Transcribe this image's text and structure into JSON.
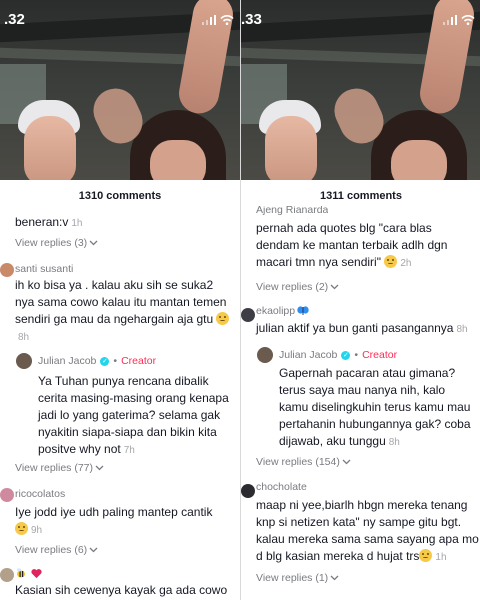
{
  "left": {
    "status": {
      "time": ".32"
    },
    "comment_count": "1310 comments",
    "comments": [
      {
        "text": "beneran:v",
        "time": "1h",
        "replies": "View replies (3)"
      },
      {
        "username": "santi susanti",
        "text": "ih ko bisa ya . kalau aku sih se suka2 nya sama cowo kalau itu mantan temen sendiri ga mau da ngehargain aja gtu",
        "time": "8h"
      },
      {
        "username": "Julian Jacob",
        "creator_label": "Creator",
        "text": "Ya Tuhan punya rencana dibalik cerita masing-masing orang kenapa jadi lo yang gaterima? selama gak nyakitin siapa-siapa dan bikin kita positve why not",
        "time": "7h",
        "replies": "View replies (77)"
      },
      {
        "username": "ricocolatos",
        "text": "Iye jodd iye udh paling mantep cantik",
        "time": "9h",
        "replies": "View replies (6)"
      },
      {
        "text": "Kasian sih cewenya kayak ga ada cowo"
      }
    ]
  },
  "right": {
    "status": {
      "time": ".33"
    },
    "comment_count": "1311 comments",
    "comments": [
      {
        "username": "Ajeng Rianarda",
        "text": "pernah ada quotes blg \"cara blas dendam ke mantan terbaik adlh dgn macari tmn nya sendiri\"",
        "time": "2h",
        "replies": "View replies (2)"
      },
      {
        "username": "ekaolipp",
        "text": "julian aktif ya bun ganti pasangannya",
        "time": "8h"
      },
      {
        "username": "Julian Jacob",
        "creator_label": "Creator",
        "text": "Gapernah pacaran atau gimana? terus saya mau nanya nih, kalo kamu diselingkuhin terus kamu mau pertahanin hubungannya gak? coba dijawab, aku tunggu",
        "time": "8h",
        "replies": "View replies (154)"
      },
      {
        "username": "chocholate",
        "text": "maap ni yee,biarlh hbgn mereka tenang knp si netizen kata\" ny sampe gitu bgt. kalau mereka sama sama sayang apa mo d blg kasian mereka d hujat trs",
        "time": "1h",
        "replies": "View replies (1)"
      }
    ]
  },
  "colors": {
    "creator": "#fe2c55",
    "verified": "#20d5ec",
    "muted": "#7a7b80"
  },
  "icons": [
    "signal-icon",
    "wifi-icon",
    "verified-icon",
    "chevron-down-icon",
    "emoji-icon",
    "butterfly-icon",
    "bee-icon",
    "heart-icon"
  ]
}
